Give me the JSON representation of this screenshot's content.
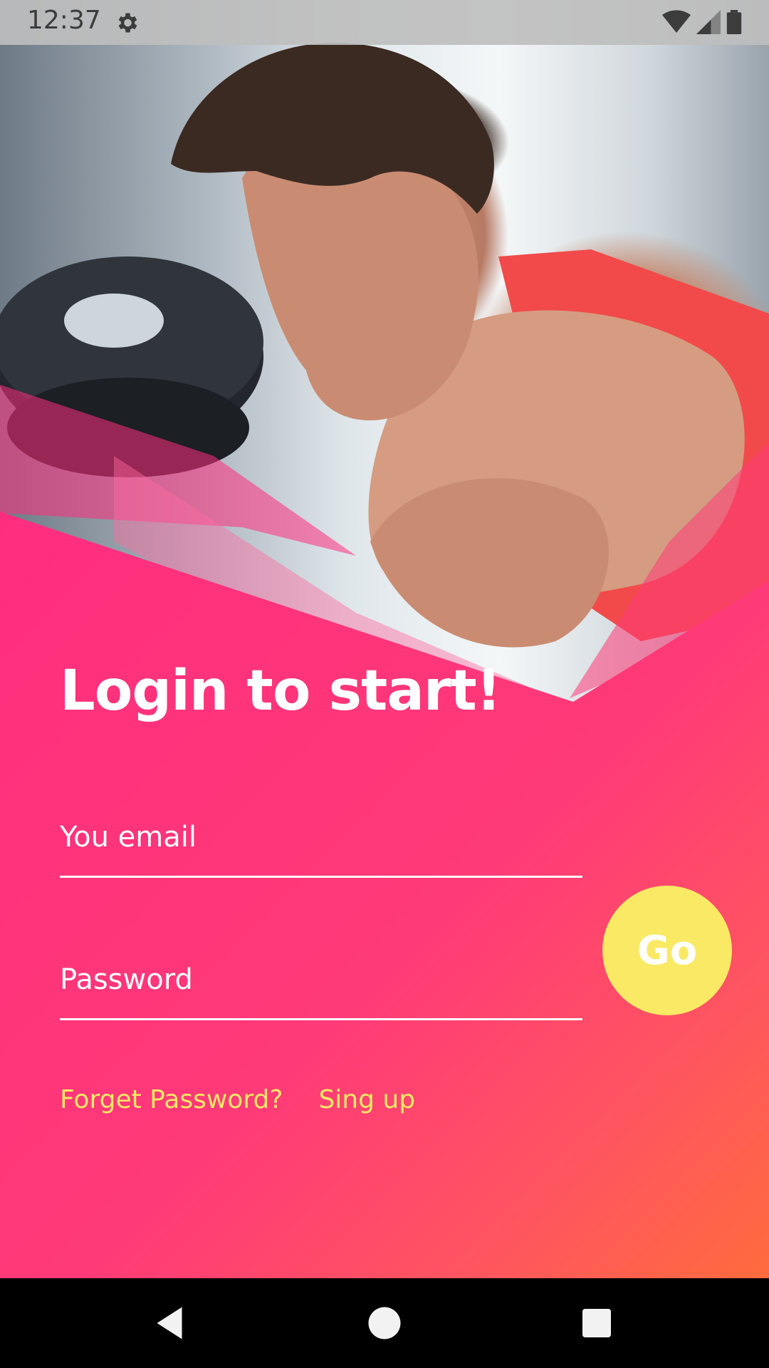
{
  "status_bar": {
    "time": "12:37",
    "icons": [
      "gear-icon",
      "wifi-icon",
      "cellular-signal-icon",
      "battery-icon"
    ]
  },
  "login": {
    "title": "Login to start!",
    "email_placeholder": "You email",
    "password_placeholder": "Password",
    "go_label": "Go",
    "forget_password_label": "Forget Password?",
    "signup_label": "Sing up"
  },
  "nav_bar": {
    "icons": [
      "back-icon",
      "home-icon",
      "recent-apps-icon"
    ]
  },
  "colors": {
    "accent_pink": "#ff3a7f",
    "accent_orange": "#ff6b3d",
    "button_yellow": "#f9e965",
    "link_yellow": "#f9e965"
  }
}
